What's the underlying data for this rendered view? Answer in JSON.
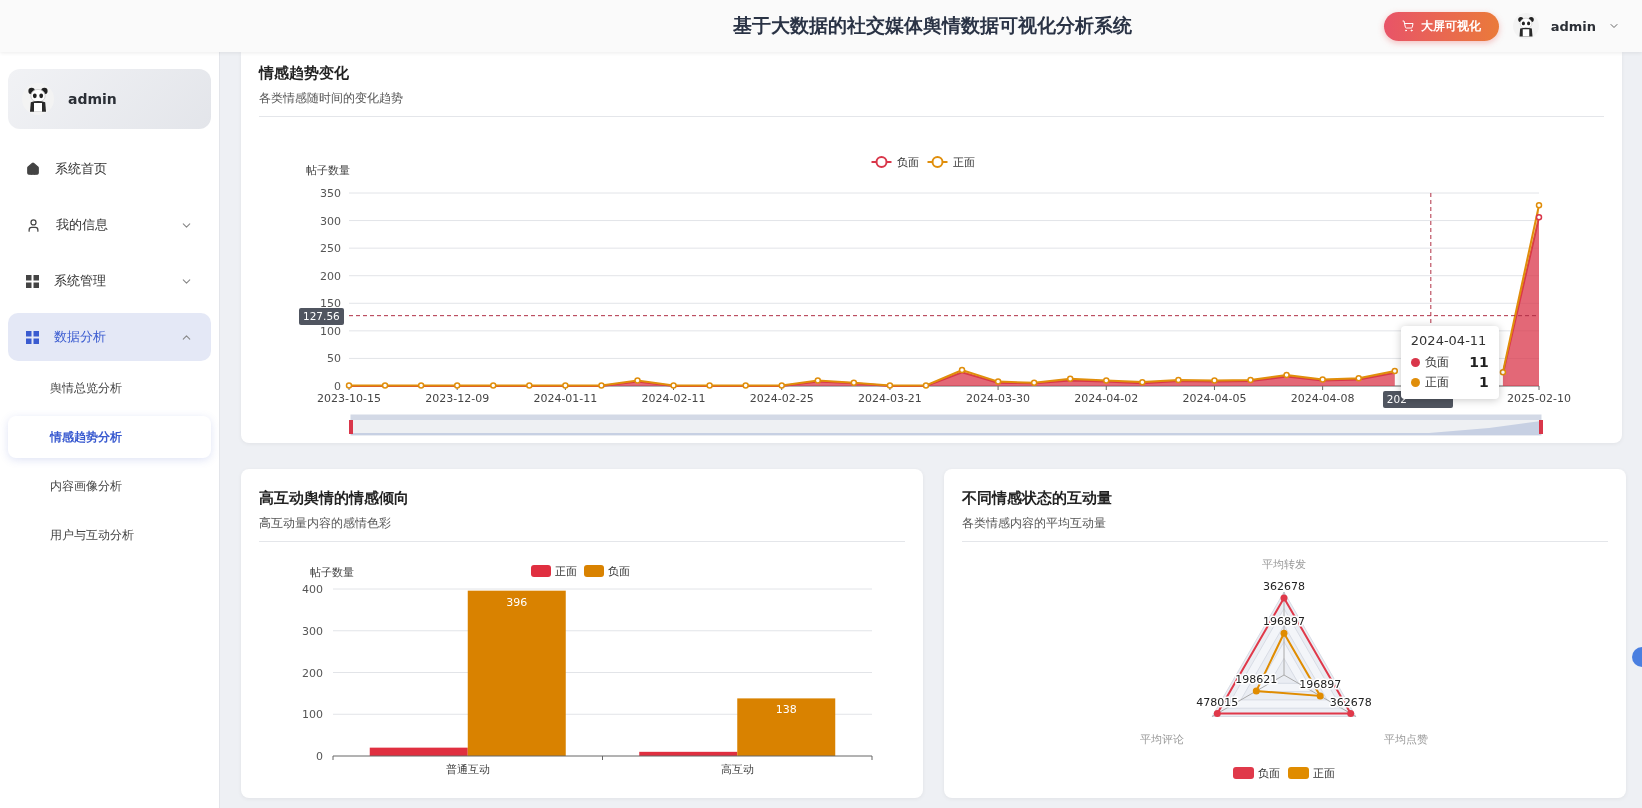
{
  "header": {
    "title": "基于大数据的社交媒体舆情数据可视化分析系统",
    "screen_button": "大屏可视化",
    "user": "admin"
  },
  "sidebar": {
    "user": "admin",
    "items": [
      {
        "label": "系统首页",
        "kind": "link",
        "selected": false
      },
      {
        "label": "我的信息",
        "kind": "group",
        "selected": false,
        "expanded": false
      },
      {
        "label": "系统管理",
        "kind": "group",
        "selected": false,
        "expanded": false
      },
      {
        "label": "数据分析",
        "kind": "group",
        "selected": true,
        "expanded": true,
        "children": [
          {
            "label": "舆情总览分析",
            "selected": false
          },
          {
            "label": "情感趋势分析",
            "selected": true
          },
          {
            "label": "内容画像分析",
            "selected": false
          },
          {
            "label": "用户与互动分析",
            "selected": false
          }
        ]
      }
    ]
  },
  "trend_card": {
    "title": "情感趋势变化",
    "subtitle": "各类情感随时间的变化趋势",
    "chart_data": {
      "type": "area",
      "stacked": true,
      "ref_lines": [
        {
          "axis": "y",
          "value": 127.56
        }
      ],
      "grid": true,
      "legend": "top",
      "ylabel": "帖子数量",
      "ylim": [
        0,
        350
      ],
      "yticks": [
        0,
        50,
        100,
        150,
        200,
        250,
        300,
        350
      ],
      "categories": [
        "2023-10-15",
        null,
        null,
        "2023-12-09",
        null,
        null,
        "2024-01-11",
        null,
        null,
        "2024-02-11",
        null,
        null,
        "2024-02-25",
        null,
        null,
        "2024-03-21",
        null,
        null,
        "2024-03-30",
        null,
        null,
        "2024-04-02",
        null,
        null,
        "2024-04-05",
        null,
        null,
        "2024-04-08",
        null,
        null,
        null,
        null,
        null,
        "2025-02-10"
      ],
      "series": [
        {
          "name": "负面",
          "color": "#d9364a",
          "values": [
            0,
            0,
            0,
            0,
            0,
            0,
            0,
            0,
            8,
            0,
            0,
            0,
            0,
            8,
            5,
            0,
            0,
            25,
            6,
            5,
            10,
            8,
            5,
            9,
            8,
            9,
            17,
            10,
            12,
            24,
            null,
            null,
            22,
            306
          ]
        },
        {
          "name": "正面",
          "color": "#e08e0b",
          "values": [
            1,
            1,
            1,
            1,
            1,
            1,
            1,
            1,
            2,
            1,
            1,
            1,
            1,
            2,
            1,
            1,
            1,
            4,
            2,
            1,
            3,
            2,
            2,
            2,
            2,
            2,
            3,
            2,
            2,
            3,
            null,
            null,
            3,
            22
          ]
        }
      ]
    },
    "pointer": {
      "y_label": "127.56",
      "x_label": "202"
    },
    "tooltip": {
      "title": "2024-04-11",
      "rows": [
        {
          "name": "负面",
          "value": "11",
          "color": "#d9364a"
        },
        {
          "name": "正面",
          "value": "1",
          "color": "#e08e0b"
        }
      ]
    }
  },
  "interaction_card": {
    "title": "高互动舆情的情感倾向",
    "subtitle": "高互动量内容的感情色彩",
    "chart_data": {
      "type": "bar",
      "grid": true,
      "legend": "top",
      "ylabel": "帖子数量",
      "ylim": [
        0,
        400
      ],
      "yticks": [
        0,
        100,
        200,
        300,
        400
      ],
      "categories": [
        "普通互动",
        "高互动"
      ],
      "series": [
        {
          "name": "正面",
          "color": "#e02f40",
          "values": [
            20,
            10
          ],
          "value_labels": [
            null,
            null
          ]
        },
        {
          "name": "负面",
          "color": "#d98200",
          "values": [
            396,
            138
          ],
          "value_labels": [
            "396",
            "138"
          ]
        }
      ]
    }
  },
  "radar_card": {
    "title": "不同情感状态的互动量",
    "subtitle": "各类情感内容的平均互动量",
    "radar": {
      "indicators": [
        "平均转发",
        "平均点赞",
        "平均评论"
      ],
      "series": [
        {
          "name": "负面",
          "color": "#e0394a",
          "values": [
            "362678",
            "362678",
            "478015"
          ]
        },
        {
          "name": "正面",
          "color": "#e08c00",
          "values": [
            "196897",
            "196897",
            "198621"
          ]
        }
      ]
    }
  }
}
